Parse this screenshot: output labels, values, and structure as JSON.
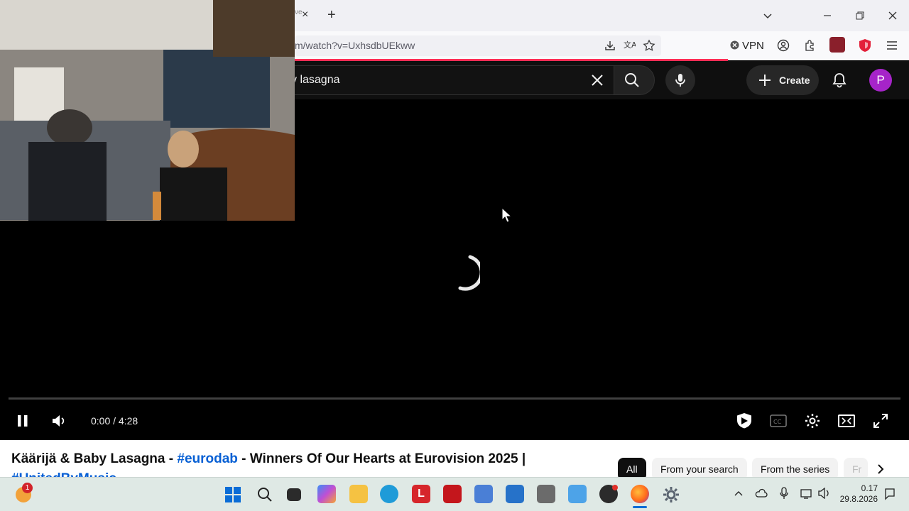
{
  "browser": {
    "tab_close": "×",
    "new_tab": "+",
    "url": "m/watch?v=UxhsdbUEkww",
    "vpn_label": "VPN"
  },
  "youtube": {
    "search_value": "y lasagna",
    "create_label": "Create",
    "avatar_letter": "P"
  },
  "player": {
    "time": "0:00 / 4:28"
  },
  "video": {
    "title_prefix": "Käärijä & Baby Lasagna - ",
    "title_tag": "#eurodab",
    "title_suffix": " - Winners Of Our Hearts at Eurovision 2025 |",
    "title_line2": "#UnitedByMusic"
  },
  "chips": [
    "All",
    "From your search",
    "From the series",
    "Fr"
  ],
  "taskbar": {
    "notification_count": "1",
    "time": "0.17",
    "date": "29.8.2026"
  }
}
